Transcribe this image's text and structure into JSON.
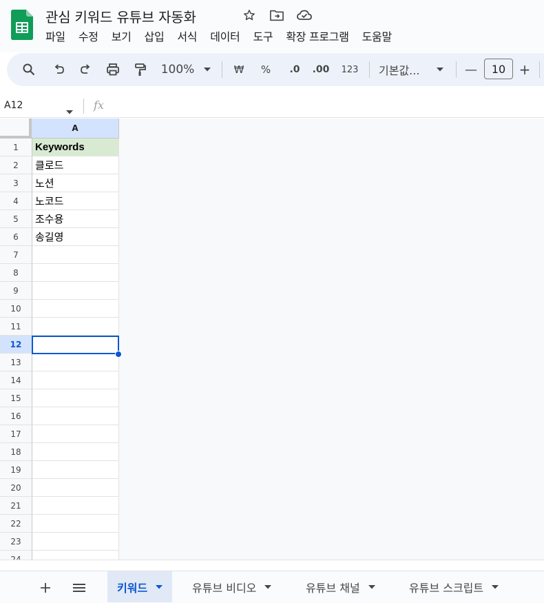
{
  "document": {
    "title": "관심 키워드 유튜브 자동화"
  },
  "menu": [
    "파일",
    "수정",
    "보기",
    "삽입",
    "서식",
    "데이터",
    "도구",
    "확장 프로그램",
    "도움말"
  ],
  "toolbar": {
    "zoom": "100%",
    "currency": "₩",
    "percent": "%",
    "decrease_decimal": ".0",
    "increase_decimal": ".00",
    "number_format": "123",
    "font": "기본값...",
    "font_size": "10",
    "minus": "—",
    "plus": "+"
  },
  "formula_bar": {
    "name_box": "A12",
    "fx": "fx",
    "value": ""
  },
  "grid": {
    "column_headers": [
      "A"
    ],
    "row_numbers": [
      "1",
      "2",
      "3",
      "4",
      "5",
      "6",
      "7",
      "8",
      "9",
      "10",
      "11",
      "12",
      "13",
      "14",
      "15",
      "16",
      "17",
      "18",
      "19",
      "20",
      "21",
      "22",
      "23",
      "24"
    ],
    "column_A": [
      "Keywords",
      "클로드",
      "노션",
      "노코드",
      "조수용",
      "송길영",
      "",
      "",
      "",
      "",
      "",
      "",
      "",
      "",
      "",
      "",
      "",
      "",
      "",
      "",
      "",
      "",
      "",
      ""
    ],
    "header_fill": "#d9ead3",
    "selected_cell": "A12"
  },
  "sheets": {
    "tabs": [
      "키워드",
      "유튜브 비디오",
      "유튜브 채널",
      "유튜브 스크립트"
    ],
    "active": "키워드"
  },
  "colors": {
    "accent": "#0b57d0",
    "logo_green": "#188038"
  }
}
